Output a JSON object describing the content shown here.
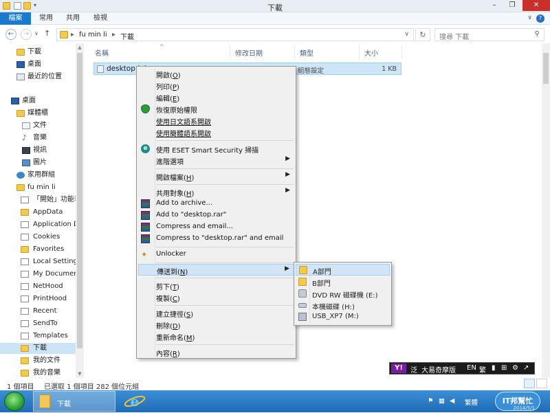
{
  "window": {
    "title": "下載",
    "controls": {
      "minimize": "–",
      "maximize": "❐",
      "close": "✕"
    }
  },
  "ribbon": {
    "tabs": [
      "檔案",
      "常用",
      "共用",
      "檢視"
    ],
    "help": "?"
  },
  "address": {
    "back": "←",
    "forward": "→",
    "up": "↑",
    "crumbs": [
      "fu min li",
      "下載"
    ],
    "separator": "▸",
    "dropdown": "∨",
    "refresh": "↻",
    "search_placeholder": "搜尋 下載",
    "search_icon": "⚲"
  },
  "nav": {
    "items": [
      {
        "label": "下載",
        "icon": "downloads-folder-icon"
      },
      {
        "label": "桌面",
        "icon": "desktop-icon"
      },
      {
        "label": "最近的位置",
        "icon": "recent-places-icon"
      },
      {
        "label": "桌面",
        "icon": "desktop-icon"
      },
      {
        "label": "媒體櫃",
        "icon": "libraries-icon"
      },
      {
        "label": "文件",
        "icon": "documents-icon"
      },
      {
        "label": "音樂",
        "icon": "music-icon"
      },
      {
        "label": "視訊",
        "icon": "videos-icon"
      },
      {
        "label": "圖片",
        "icon": "pictures-icon"
      },
      {
        "label": "家用群組",
        "icon": "homegroup-icon"
      },
      {
        "label": "fu min li",
        "icon": "user-folder-icon"
      },
      {
        "label": "「開始」功能表",
        "icon": "shortcut-folder-icon"
      },
      {
        "label": "AppData",
        "icon": "folder-icon"
      },
      {
        "label": "Application D",
        "icon": "shortcut-folder-icon"
      },
      {
        "label": "Cookies",
        "icon": "shortcut-folder-icon"
      },
      {
        "label": "Favorites",
        "icon": "folder-icon"
      },
      {
        "label": "Local Settings",
        "icon": "shortcut-folder-icon"
      },
      {
        "label": "My Document",
        "icon": "shortcut-folder-icon"
      },
      {
        "label": "NetHood",
        "icon": "shortcut-folder-icon"
      },
      {
        "label": "PrintHood",
        "icon": "shortcut-folder-icon"
      },
      {
        "label": "Recent",
        "icon": "shortcut-folder-icon"
      },
      {
        "label": "SendTo",
        "icon": "shortcut-folder-icon"
      },
      {
        "label": "Templates",
        "icon": "shortcut-folder-icon"
      },
      {
        "label": "下載",
        "icon": "downloads-folder-icon"
      },
      {
        "label": "我的文件",
        "icon": "folder-icon"
      },
      {
        "label": "我的音樂",
        "icon": "folder-icon"
      }
    ]
  },
  "filelist": {
    "columns": [
      "名稱",
      "修改日期",
      "類型",
      "大小"
    ],
    "sort_caret": "^",
    "rows": [
      {
        "name": "desktop.ini",
        "type": "組態設定",
        "size": "1 KB"
      }
    ]
  },
  "context_menu": {
    "items": [
      {
        "label": "開啟(",
        "key": "O",
        "tail": ")"
      },
      {
        "label": "列印(",
        "key": "P",
        "tail": ")"
      },
      {
        "label": "編輯(",
        "key": "E",
        "tail": ")"
      },
      {
        "label": "恢復原始權限"
      },
      {
        "label": "使用日文語系開啟"
      },
      {
        "label": "使用簡體語系開啟"
      },
      {
        "label": "使用 ESET Smart Security 掃描"
      },
      {
        "label": "進階選項"
      },
      {
        "label": "開啟檔案(",
        "key": "H",
        "tail": ")"
      },
      {
        "label": "共用對象(",
        "key": "H",
        "tail": ")"
      },
      {
        "label": "Add to archive..."
      },
      {
        "label": "Add to \"desktop.rar\""
      },
      {
        "label": "Compress and email..."
      },
      {
        "label": "Compress to \"desktop.rar\" and email"
      },
      {
        "label": "Unlocker"
      },
      {
        "label": "傳送到(",
        "key": "N",
        "tail": ")"
      },
      {
        "label": "剪下(",
        "key": "T",
        "tail": ")"
      },
      {
        "label": "複製(",
        "key": "C",
        "tail": ")"
      },
      {
        "label": "建立捷徑(",
        "key": "S",
        "tail": ")"
      },
      {
        "label": "刪除(",
        "key": "D",
        "tail": ")"
      },
      {
        "label": "重新命名(",
        "key": "M",
        "tail": ")"
      },
      {
        "label": "內容(",
        "key": "R",
        "tail": ")"
      }
    ],
    "arrow": "▶"
  },
  "send_to": {
    "items": [
      {
        "label": "A部門",
        "icon": "folder-icon"
      },
      {
        "label": "B部門",
        "icon": "folder-icon"
      },
      {
        "label": "DVD RW 磁碟機 (E:)",
        "icon": "dvd-drive-icon"
      },
      {
        "label": "本機磁碟 (H:)",
        "icon": "hard-drive-icon"
      },
      {
        "label": "USB_XP7 (M:)",
        "icon": "usb-drive-icon"
      }
    ]
  },
  "status": {
    "count": "1 個項目",
    "selected": "已選取 1 個項目 282 個位元組"
  },
  "ime": {
    "logo": "Y!",
    "mode": "泛",
    "name": "大易奇摩版",
    "lang": "EN",
    "script": "繁"
  },
  "taskbar": {
    "explorer_label": "下載",
    "tray_lang": "繁體",
    "logo_text": "IT邦幫忙",
    "date": "2014/5/1"
  }
}
